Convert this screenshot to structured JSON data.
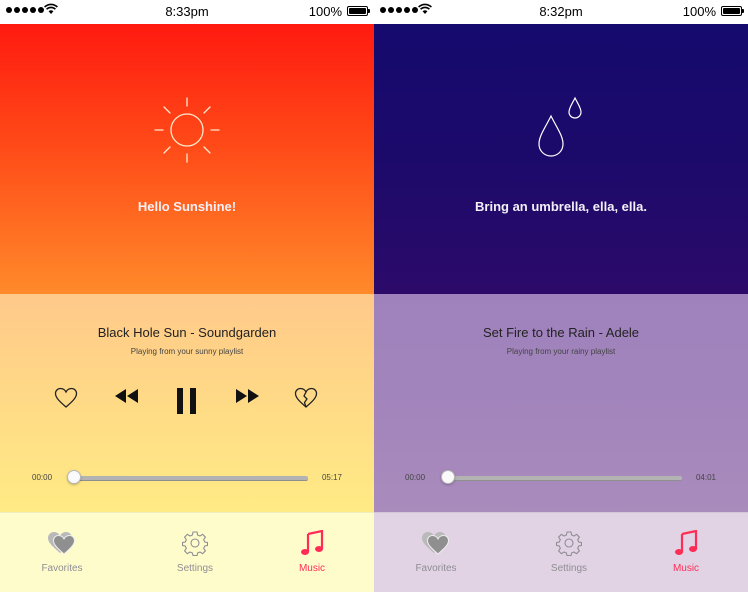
{
  "screens": [
    {
      "theme": "sunny",
      "status_bar": {
        "time": "8:33pm",
        "battery": "100%"
      },
      "weather": {
        "icon": "sun-icon",
        "message": "Hello Sunshine!"
      },
      "player": {
        "song": "Black Hole Sun - Soundgarden",
        "subtitle": "Playing from your sunny playlist",
        "elapsed": "00:00",
        "total": "05:17",
        "progress": 0.0
      },
      "tabs": [
        {
          "label": "Favorites",
          "icon": "heart-icon",
          "active": false
        },
        {
          "label": "Settings",
          "icon": "gear-icon",
          "active": false
        },
        {
          "label": "Music",
          "icon": "music-note-icon",
          "active": true
        }
      ],
      "colors": {
        "weather_top": "#ff1a10",
        "weather_bottom": "#ff8a2a",
        "player_top": "#ffc98a",
        "player_bottom": "#ffeb85",
        "tabbar": "#fffccc"
      }
    },
    {
      "theme": "rainy",
      "status_bar": {
        "time": "8:32pm",
        "battery": "100%"
      },
      "weather": {
        "icon": "raindrops-icon",
        "message": "Bring an umbrella, ella, ella."
      },
      "player": {
        "song": "Set Fire to the Rain - Adele",
        "subtitle": "Playing from your rainy playlist",
        "elapsed": "00:00",
        "total": "04:01",
        "progress": 0.0
      },
      "tabs": [
        {
          "label": "Favorites",
          "icon": "heart-icon",
          "active": false
        },
        {
          "label": "Settings",
          "icon": "gear-icon",
          "active": false
        },
        {
          "label": "Music",
          "icon": "music-note-icon",
          "active": true
        }
      ],
      "colors": {
        "weather_top": "#150a6e",
        "weather_bottom": "#2c0a6a",
        "player_top": "#9f82bc",
        "player_bottom": "#a98bbc",
        "tabbar": "#e2d3e4"
      }
    }
  ],
  "accent_color": "#ff2d55"
}
